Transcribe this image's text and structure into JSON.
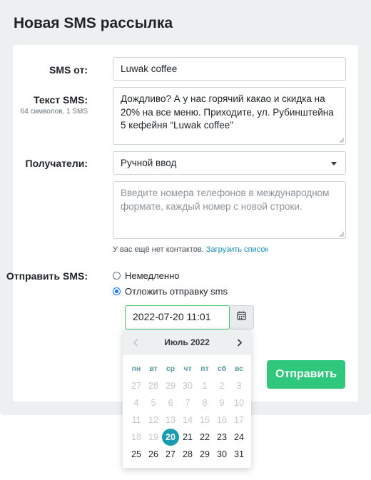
{
  "page": {
    "title": "Новая SMS рассылка"
  },
  "form": {
    "sender": {
      "label": "SMS от:",
      "value": "Luwak coffee"
    },
    "text": {
      "label": "Текст SMS:",
      "sublabel": "64 символов, 1 SMS",
      "lines": [
        "Дождливо? А у нас горячий какао и скидка на",
        "20% на все меню. Приходите, ул. Рубинштейна",
        "5 кефейня “Luwak coffee”"
      ]
    },
    "recipients": {
      "label": "Получатели:",
      "selected": "Ручной ввод",
      "placeholder_lines": [
        "Введите номера телефонов в международном",
        "формате, каждый номер с новой строки."
      ],
      "hint_text": "У вас ещё нет контактов.",
      "hint_link": "Загрузить список"
    },
    "send": {
      "label": "Отправить SMS:",
      "option_now": "Немедленно",
      "option_delay": "Отложить отправку sms",
      "selected_option": "option_delay",
      "datetime": "2022-07-20 11:01"
    },
    "submit_label": "Отправить"
  },
  "calendar": {
    "month_label": "Июль 2022",
    "weekdays": [
      "пн",
      "вт",
      "ср",
      "чт",
      "пт",
      "сб",
      "вс"
    ],
    "selected_day": "20",
    "weeks": [
      [
        {
          "d": "27",
          "m": true
        },
        {
          "d": "28",
          "m": true
        },
        {
          "d": "29",
          "m": true
        },
        {
          "d": "30",
          "m": true
        },
        {
          "d": "1",
          "m": true
        },
        {
          "d": "2",
          "m": true
        },
        {
          "d": "3",
          "m": true
        }
      ],
      [
        {
          "d": "4",
          "m": true
        },
        {
          "d": "5",
          "m": true
        },
        {
          "d": "6",
          "m": true
        },
        {
          "d": "7",
          "m": true
        },
        {
          "d": "8",
          "m": true
        },
        {
          "d": "9",
          "m": true
        },
        {
          "d": "10",
          "m": true
        }
      ],
      [
        {
          "d": "11",
          "m": true
        },
        {
          "d": "12",
          "m": true
        },
        {
          "d": "13",
          "m": true
        },
        {
          "d": "14",
          "m": true
        },
        {
          "d": "15",
          "m": true
        },
        {
          "d": "16",
          "m": true
        },
        {
          "d": "17",
          "m": true
        }
      ],
      [
        {
          "d": "18",
          "m": true
        },
        {
          "d": "19",
          "m": true
        },
        {
          "d": "20",
          "m": false
        },
        {
          "d": "21",
          "m": false
        },
        {
          "d": "22",
          "m": false
        },
        {
          "d": "23",
          "m": false
        },
        {
          "d": "24",
          "m": false
        }
      ],
      [
        {
          "d": "25",
          "m": false
        },
        {
          "d": "26",
          "m": false
        },
        {
          "d": "27",
          "m": false
        },
        {
          "d": "28",
          "m": false
        },
        {
          "d": "29",
          "m": false
        },
        {
          "d": "30",
          "m": false
        },
        {
          "d": "31",
          "m": false
        }
      ]
    ]
  },
  "colors": {
    "accent_green": "#2fc77b",
    "focus_green": "#43c46e",
    "selected_day": "#1a9bb1",
    "link": "#1a8fb6",
    "background": "#ecf0f1"
  }
}
